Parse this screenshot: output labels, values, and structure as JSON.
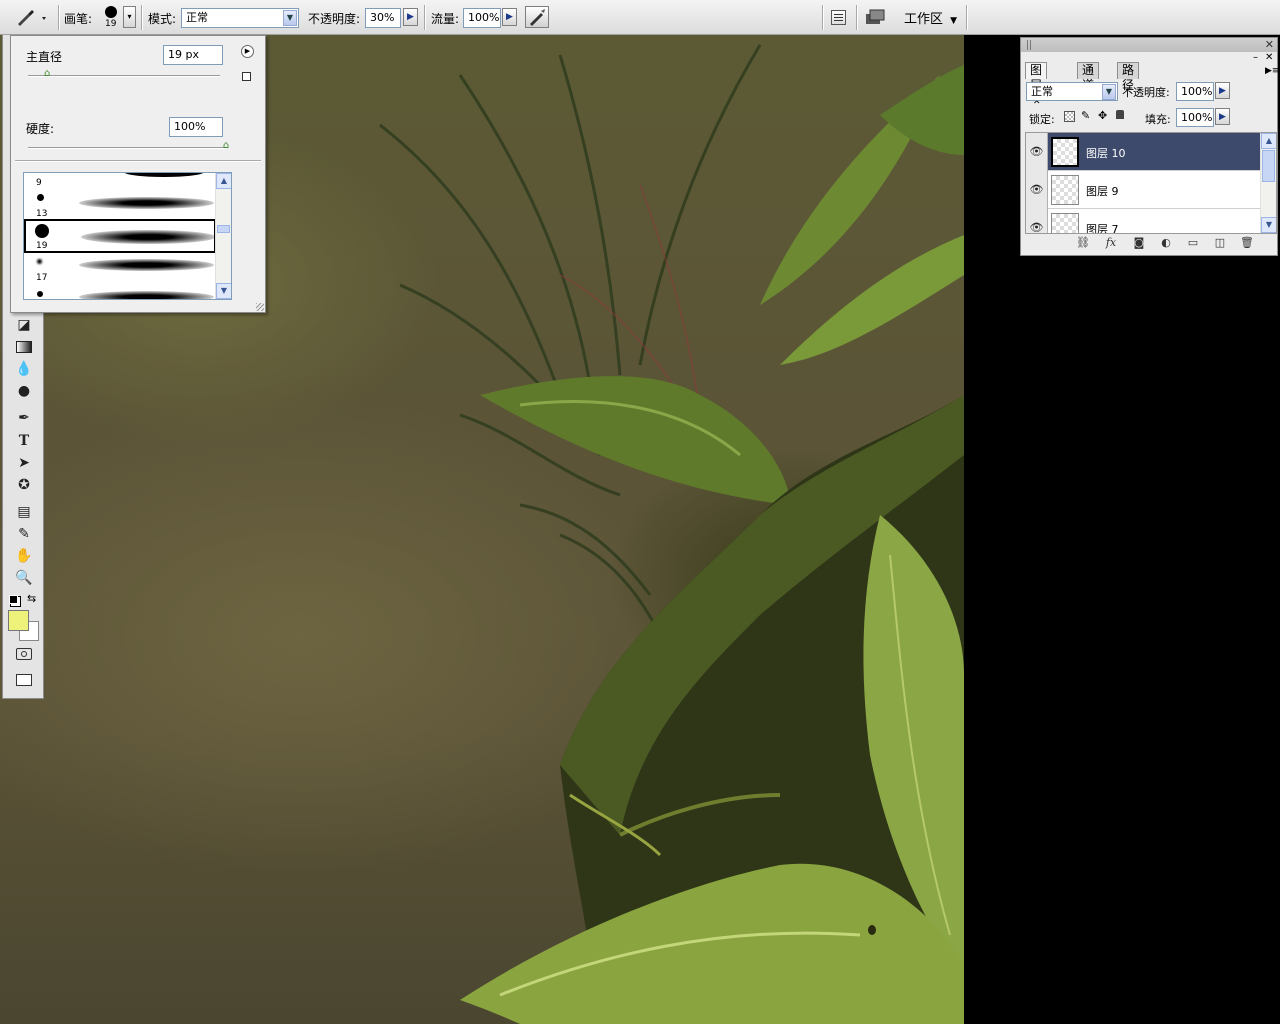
{
  "options_bar": {
    "brush_label": "画笔:",
    "brush_size": "19",
    "mode_label": "模式:",
    "mode_value": "正常",
    "opacity_label": "不透明度:",
    "opacity_value": "30%",
    "flow_label": "流量:",
    "flow_value": "100%",
    "workspace_label": "工作区"
  },
  "brush_popup": {
    "diameter_label": "主直径",
    "diameter_value": "19 px",
    "diameter_level": 0.1,
    "hardness_label": "硬度:",
    "hardness_value": "100%",
    "hardness_level": 1.0,
    "presets": [
      {
        "size": "9"
      },
      {
        "size": "13"
      },
      {
        "size": "19",
        "selected": true
      },
      {
        "size": "17"
      }
    ]
  },
  "layers_panel": {
    "tabs": [
      "图层",
      "通道",
      "路径"
    ],
    "active_tab": "图层",
    "blend_mode": "正常",
    "opacity_label": "不透明度:",
    "opacity_value": "100%",
    "lock_label": "锁定:",
    "fill_label": "填充:",
    "fill_value": "100%",
    "layers": [
      {
        "name": "图层 10",
        "selected": true
      },
      {
        "name": "图层 9",
        "selected": false
      },
      {
        "name": "图层 7",
        "selected": false
      }
    ],
    "footer_icons": [
      "link-icon",
      "fx-icon",
      "mask-icon",
      "adjustment-icon",
      "group-icon",
      "new-layer-icon",
      "trash-icon"
    ]
  },
  "colors": {
    "foreground": "#eef27a",
    "background": "#ffffff",
    "selected_layer": "#3d4a6b"
  }
}
